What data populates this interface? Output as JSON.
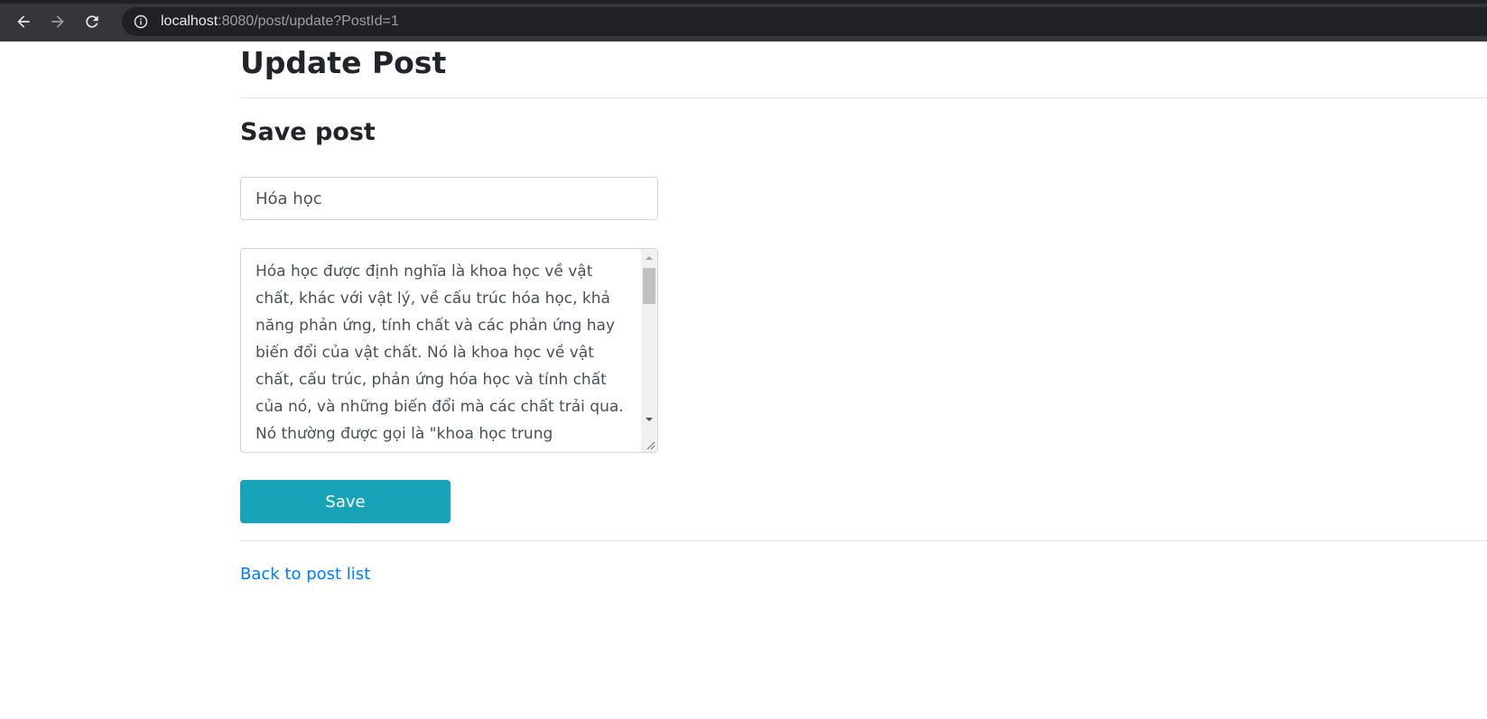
{
  "browser": {
    "url_host": "localhost",
    "url_rest": ":8080/post/update?PostId=1",
    "icons": [
      "back-arrow-icon",
      "forward-arrow-icon",
      "reload-icon",
      "info-icon"
    ]
  },
  "page": {
    "title": "Update Post",
    "section_title": "Save post"
  },
  "form": {
    "title_value": "Hóa học",
    "content_value": "Hóa học được định nghĩa là khoa học về vật chất, khác với vật lý, về cấu trúc hóa học, khả năng phản ứng, tính chất và các phản ứng hay biến đổi của vật chất. Nó là khoa học về vật chất, cấu trúc, phản ứng hóa học và tính chất của nó, và những biến đổi mà các chất trải qua. Nó thường được gọi là \"khoa học trung",
    "save_label": "Save"
  },
  "links": {
    "back_label": "Back to post list"
  },
  "colors": {
    "accent": "#17a2b8",
    "link": "#007bff",
    "chrome_bg": "#35363a"
  }
}
